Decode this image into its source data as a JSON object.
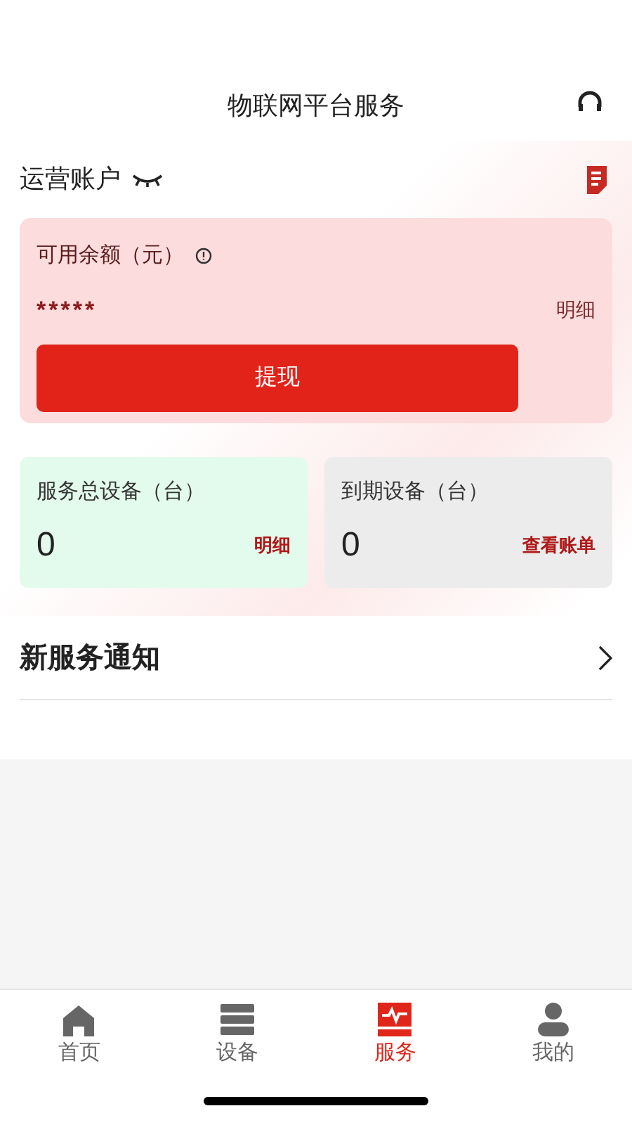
{
  "header": {
    "title": "物联网平台服务"
  },
  "account": {
    "title": "运营账户",
    "balance_label": "可用余额（元）",
    "balance": "*****",
    "detail_link": "明细",
    "withdraw_button": "提现"
  },
  "stats": [
    {
      "label": "服务总设备（台）",
      "value": "0",
      "link": "明细",
      "color": "#e3fbec"
    },
    {
      "label": "到期设备（台）",
      "value": "0",
      "link": "查看账单",
      "color": "#ececec"
    }
  ],
  "notice": {
    "title": "新服务通知"
  },
  "tabs": [
    {
      "kind": "home",
      "label": "首页",
      "selected": false
    },
    {
      "kind": "devices",
      "label": "设备",
      "selected": false
    },
    {
      "kind": "service",
      "label": "服务",
      "selected": true
    },
    {
      "kind": "profile",
      "label": "我的",
      "selected": false
    }
  ]
}
